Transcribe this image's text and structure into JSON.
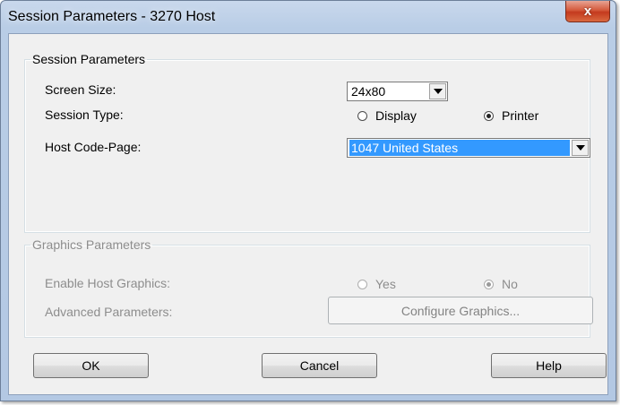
{
  "window": {
    "title": "Session Parameters - 3270 Host",
    "close_glyph": "x"
  },
  "session_group": {
    "legend": "Session Parameters",
    "screen_size": {
      "label": "Screen Size:",
      "value": "24x80"
    },
    "session_type": {
      "label": "Session Type:",
      "options": [
        {
          "label": "Display",
          "selected": false
        },
        {
          "label": "Printer",
          "selected": true
        }
      ]
    },
    "host_code_page": {
      "label": "Host Code-Page:",
      "value": "1047 United States"
    }
  },
  "graphics_group": {
    "legend": "Graphics Parameters",
    "enable_host_graphics": {
      "label": "Enable Host Graphics:",
      "options": [
        {
          "label": "Yes",
          "selected": false
        },
        {
          "label": "No",
          "selected": true
        }
      ]
    },
    "advanced": {
      "label": "Advanced Parameters:",
      "button": "Configure Graphics..."
    }
  },
  "buttons": {
    "ok": "OK",
    "cancel": "Cancel",
    "help": "Help"
  },
  "icons": {
    "close": "close-icon",
    "dropdown": "chevron-down-icon"
  }
}
